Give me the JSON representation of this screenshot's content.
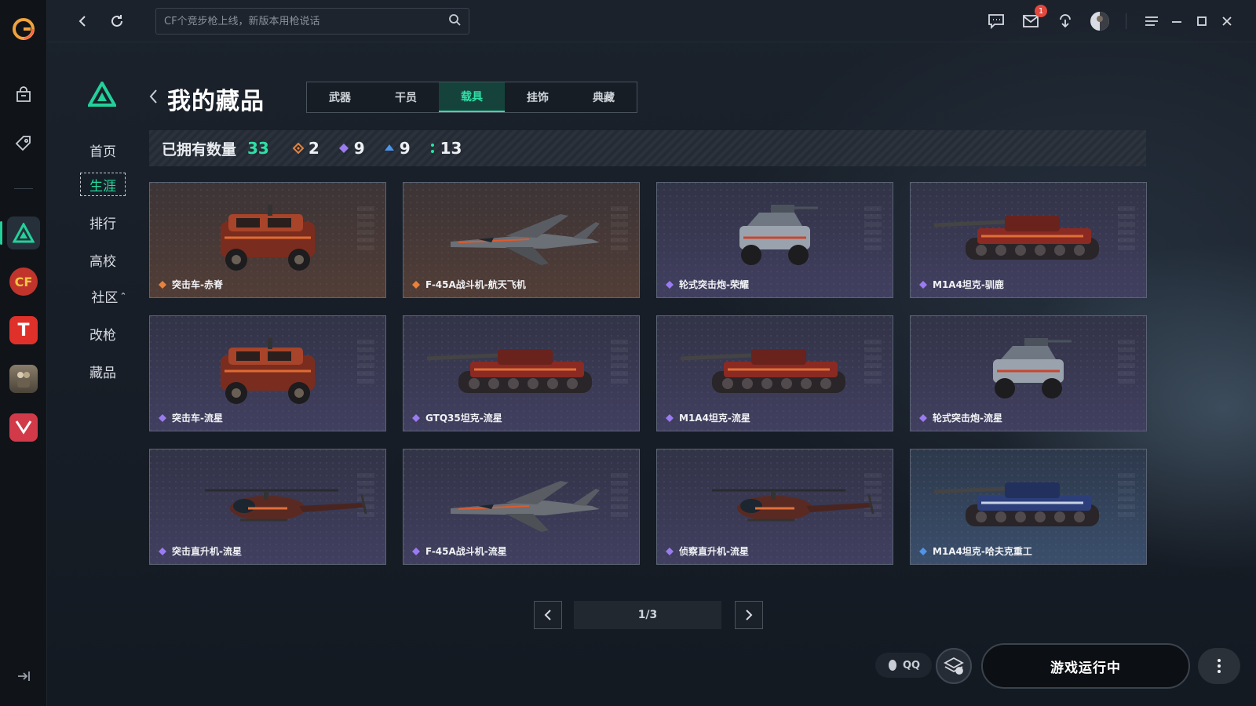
{
  "topbar": {
    "search_placeholder": "CF个竞步枪上线，新版本用枪说话",
    "mail_badge": "1"
  },
  "rail": {
    "items": [
      {
        "icon": "app-logo-icon"
      },
      {
        "icon": "store-bag-icon"
      },
      {
        "icon": "tag-icon"
      },
      {
        "icon": "career-triangle-icon",
        "active": true
      },
      {
        "icon": "crossfire-game-icon"
      },
      {
        "icon": "t-game-icon"
      },
      {
        "icon": "soldier-game-icon"
      },
      {
        "icon": "v-game-icon"
      }
    ]
  },
  "subnav": {
    "items": [
      {
        "label": "首页",
        "active": false
      },
      {
        "label": "生涯",
        "active": true
      },
      {
        "label": "排行",
        "active": false
      },
      {
        "label": "高校",
        "active": false
      },
      {
        "label": "社区",
        "active": false,
        "expand": "⌃"
      },
      {
        "label": "改枪",
        "active": false
      },
      {
        "label": "藏品",
        "active": false
      }
    ]
  },
  "page": {
    "title": "我的藏品",
    "tabs": [
      {
        "label": "武器",
        "active": false
      },
      {
        "label": "干员",
        "active": false
      },
      {
        "label": "载具",
        "active": true
      },
      {
        "label": "挂饰",
        "active": false
      },
      {
        "label": "典藏",
        "active": false
      }
    ]
  },
  "stats": {
    "label": "已拥有数量",
    "total": "33",
    "groups": [
      {
        "icon": "diamond-orange-icon",
        "value": "2",
        "color": "#e8823a"
      },
      {
        "icon": "diamond-purple-icon",
        "value": "9",
        "color": "#9a7bf0"
      },
      {
        "icon": "diamond-blue-icon",
        "value": "9",
        "color": "#4f94e8"
      },
      {
        "icon": "dots-green-icon",
        "value": "13",
        "color": "#2fe0a6"
      }
    ]
  },
  "items": [
    {
      "name": "突击车-赤脊",
      "rarity": "orange",
      "type": "car"
    },
    {
      "name": "F-45A战斗机-航天飞机",
      "rarity": "orange",
      "type": "jet"
    },
    {
      "name": "轮式突击炮-荣耀",
      "rarity": "purple",
      "type": "buggy"
    },
    {
      "name": "M1A4坦克-驯鹿",
      "rarity": "purple",
      "type": "tank"
    },
    {
      "name": "突击车-流星",
      "rarity": "purple",
      "type": "car"
    },
    {
      "name": "GTQ35坦克-流星",
      "rarity": "purple",
      "type": "tank"
    },
    {
      "name": "M1A4坦克-流星",
      "rarity": "purple",
      "type": "tank"
    },
    {
      "name": "轮式突击炮-流星",
      "rarity": "purple",
      "type": "buggy"
    },
    {
      "name": "突击直升机-流星",
      "rarity": "purple",
      "type": "heli"
    },
    {
      "name": "F-45A战斗机-流星",
      "rarity": "purple",
      "type": "jet"
    },
    {
      "name": "侦察直升机-流星",
      "rarity": "purple",
      "type": "heli"
    },
    {
      "name": "M1A4坦克-哈夫克重工",
      "rarity": "blue",
      "type": "tank"
    }
  ],
  "pagination": {
    "indicator": "1/3"
  },
  "bottom": {
    "qq_label": "QQ",
    "run_label": "游戏运行中"
  },
  "colors": {
    "accent": "#2fe0a6",
    "orange": "#e8823a",
    "purple": "#9a7bf0",
    "blue": "#4f94e8"
  }
}
